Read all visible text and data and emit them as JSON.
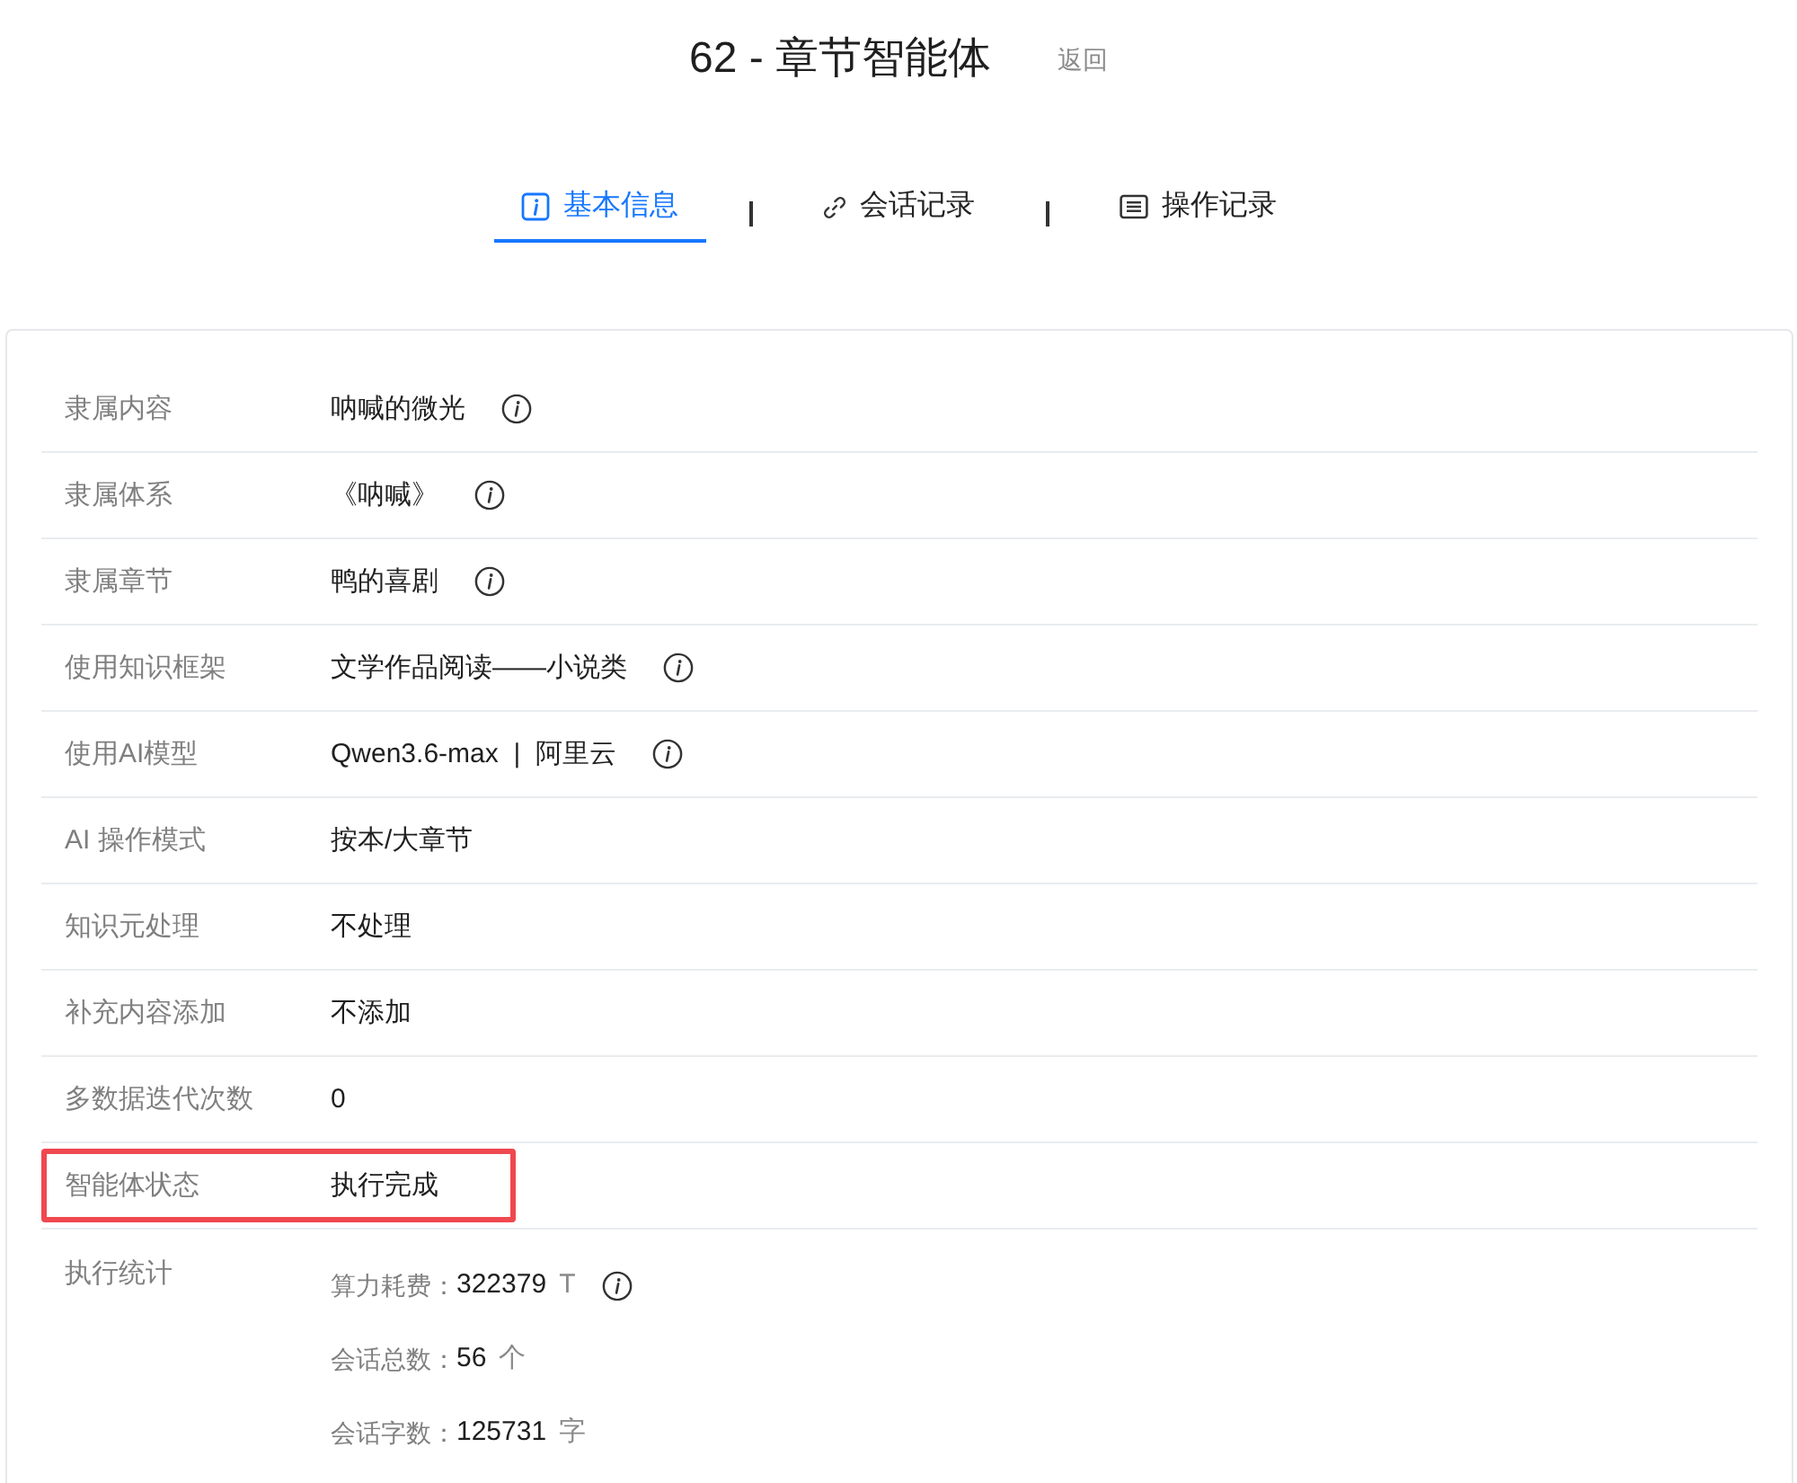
{
  "header": {
    "title": "62 - 章节智能体",
    "back_link": "返回"
  },
  "tabs": [
    {
      "label": "基本信息",
      "selected": true
    },
    {
      "label": "会话记录",
      "selected": false
    },
    {
      "label": "操作记录",
      "selected": false
    }
  ],
  "details": [
    {
      "label": "隶属内容",
      "value": "呐喊的微光",
      "info": true,
      "highlighted": false
    },
    {
      "label": "隶属体系",
      "value": "《呐喊》",
      "info": true,
      "highlighted": false
    },
    {
      "label": "隶属章节",
      "value": "鸭的喜剧",
      "info": true,
      "highlighted": false
    },
    {
      "label": "使用知识框架",
      "value": "文学作品阅读——小说类",
      "info": true,
      "highlighted": false
    },
    {
      "label": "使用AI模型",
      "value": "Qwen3.6-max  |  阿里云",
      "info": true,
      "highlighted": false
    },
    {
      "label": "AI 操作模式",
      "value": "按本/大章节",
      "info": false,
      "highlighted": false
    },
    {
      "label": "知识元处理",
      "value": "不处理",
      "info": false,
      "highlighted": false
    },
    {
      "label": "补充内容添加",
      "value": "不添加",
      "info": false,
      "highlighted": false
    },
    {
      "label": "多数据迭代次数",
      "value": "0",
      "info": false,
      "highlighted": false
    },
    {
      "label": "智能体状态",
      "value": "执行完成",
      "info": false,
      "highlighted": true
    }
  ],
  "stats": {
    "label": "执行统计",
    "items": [
      {
        "label": "算力耗费：",
        "value": "322379",
        "unit": "T",
        "info": true
      },
      {
        "label": "会话总数：",
        "value": "56",
        "unit": "个",
        "info": false
      },
      {
        "label": "会话字数：",
        "value": "125731",
        "unit": "字",
        "info": false
      }
    ]
  }
}
